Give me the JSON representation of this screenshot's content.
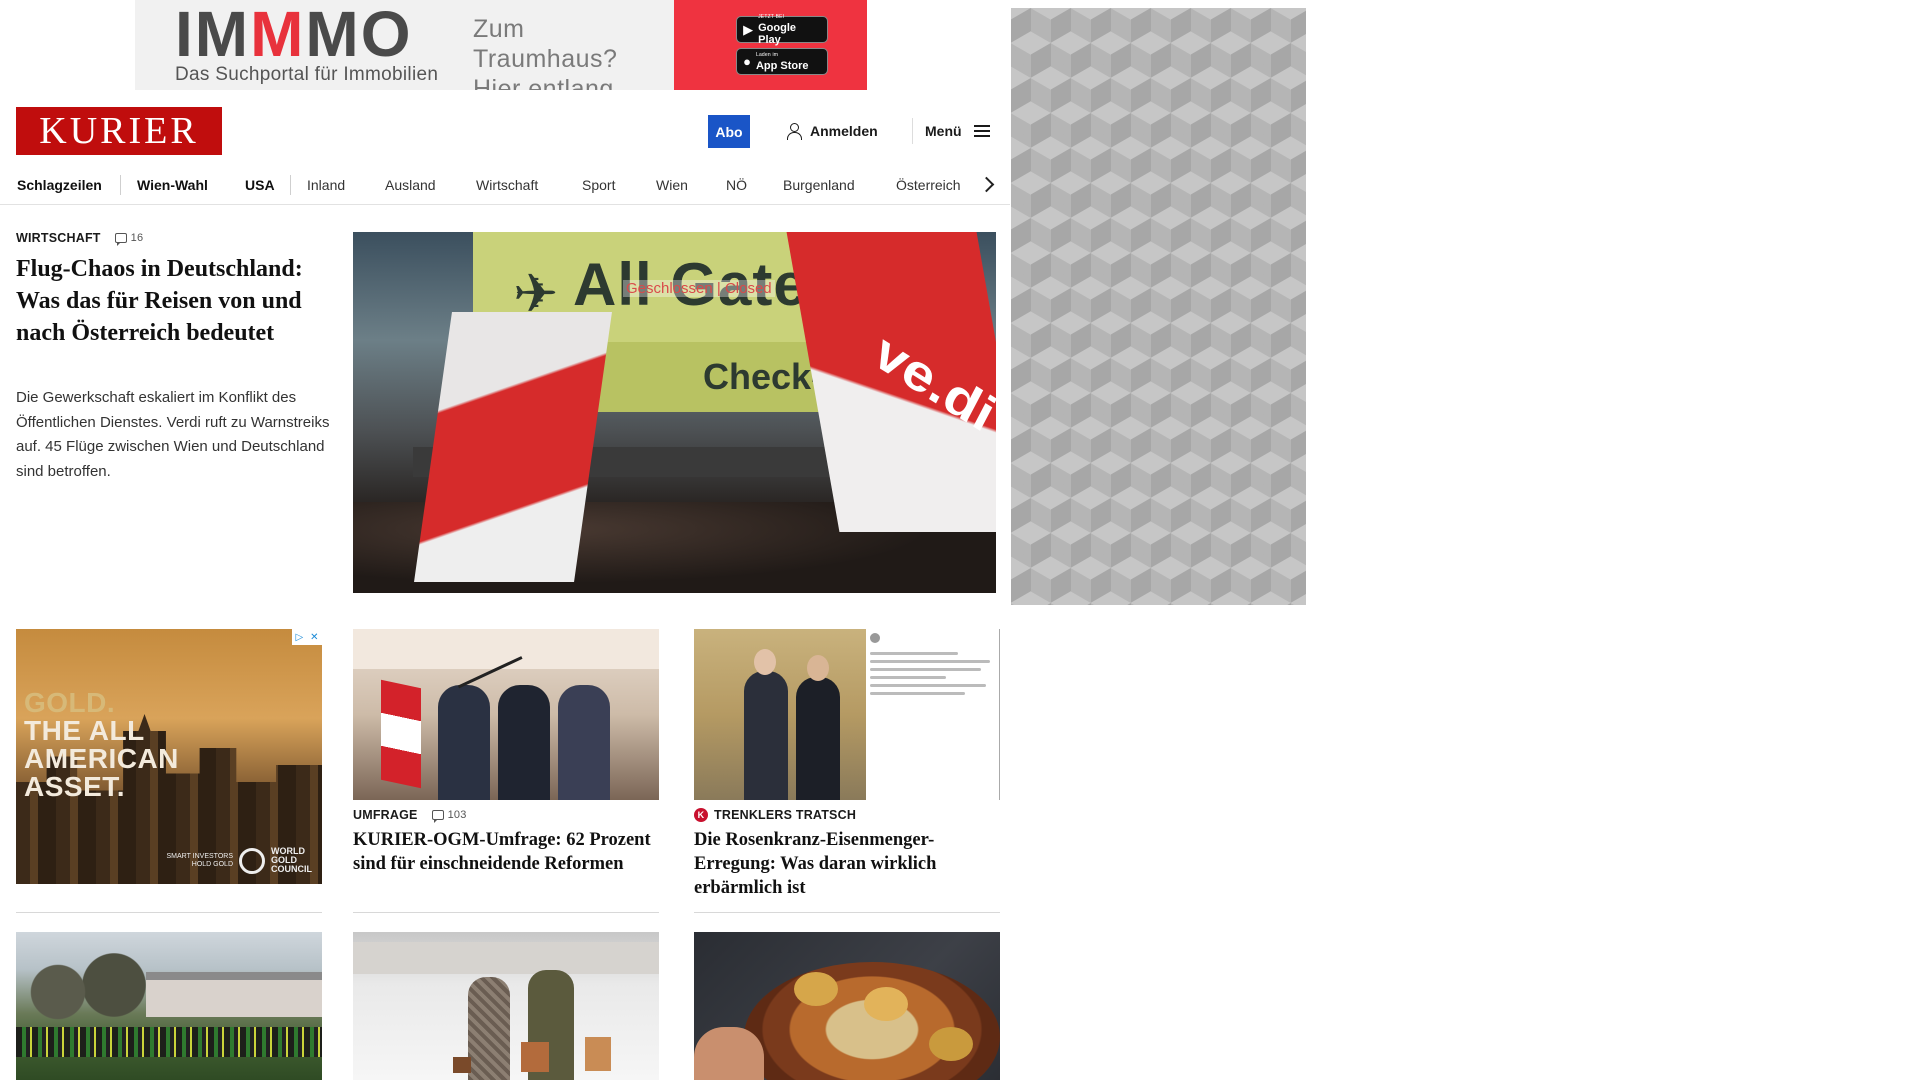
{
  "ads": {
    "top": {
      "brand_part1": "IM",
      "brand_part2": "M",
      "brand_part3": "MO",
      "tagline": "Das Suchportal für Immobilien",
      "claim_line1": "Zum Traumhaus?",
      "claim_line2": "Hier entlang.",
      "google_small": "JETZT BEI",
      "google_big": "Google Play",
      "apple_small": "Laden im",
      "apple_big": "App Store",
      "accent_color": "#ef3340"
    },
    "gold": {
      "line1": "GOLD.",
      "line2": "THE ALL",
      "line3": "AMERICAN",
      "line4": "ASSET.",
      "small_print_1": "SMART INVESTORS",
      "small_print_2": "HOLD GOLD",
      "sponsor_1": "WORLD",
      "sponsor_2": "GOLD",
      "sponsor_3": "COUNCIL"
    }
  },
  "header": {
    "logo": "KURIER",
    "logo_color": "#c00d0d",
    "abo_label": "Abo",
    "abo_color": "#1a55c7",
    "login_label": "Anmelden",
    "menu_label": "Menü"
  },
  "nav": {
    "items": [
      "Schlagzeilen",
      "Wien-Wahl",
      "USA",
      "Inland",
      "Ausland",
      "Wirtschaft",
      "Sport",
      "Wien",
      "NÖ",
      "Burgenland",
      "Österreich"
    ]
  },
  "lead": {
    "kicker": "Wirtschaft",
    "comments": "16",
    "title": "Flug-Chaos in Deutschland: Was das für Reisen von und nach Österreich bedeutet",
    "teaser": "Die Gewerkschaft eskaliert im Konflikt des Öffentlichen Dienstes. Verdi ruft zu Warnstreiks auf. 45 Flüge zwischen Wien und Deutschland sind betroffen.",
    "image": {
      "sign_text": "All Gates",
      "closed_text": "Geschlossen | Closed",
      "checkin_text": "Check-in",
      "flag_text": "ve.di"
    }
  },
  "cards": [
    {
      "kicker": "Umfrage",
      "comments": "103",
      "title": "KURIER-OGM-Umfrage: 62 Prozent sind für einschneidende Reformen"
    },
    {
      "kicker": "Trenklers Tratsch",
      "badge": "K",
      "title": "Die Rosenkranz-Eisenmenger-Erregung: Was daran wirklich erbärmlich ist"
    }
  ]
}
